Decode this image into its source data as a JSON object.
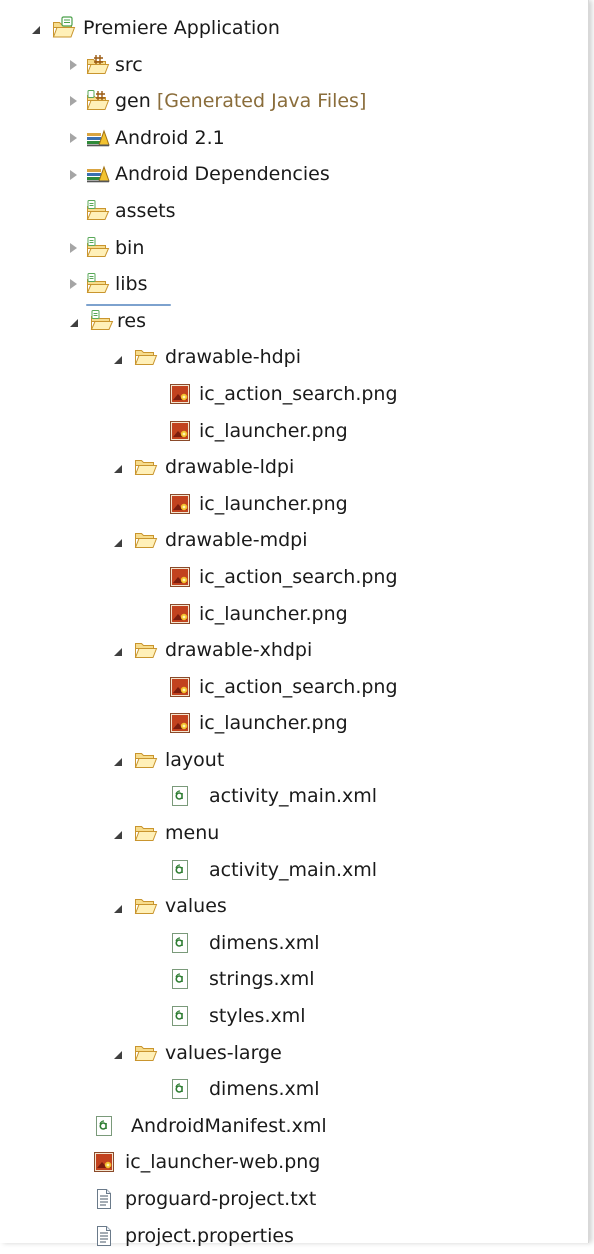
{
  "tree": {
    "project": {
      "label": "Premiere Application"
    },
    "src": {
      "label": "src"
    },
    "gen": {
      "label": "gen",
      "suffix": "[Generated Java Files]"
    },
    "android_lib": {
      "label": "Android 2.1"
    },
    "android_deps": {
      "label": "Android Dependencies"
    },
    "assets": {
      "label": "assets"
    },
    "bin": {
      "label": "bin"
    },
    "libs": {
      "label": "libs"
    },
    "res": {
      "label": "res"
    },
    "drawable_hdpi": {
      "label": "drawable-hdpi"
    },
    "hdpi_search": {
      "label": "ic_action_search.png"
    },
    "hdpi_launcher": {
      "label": "ic_launcher.png"
    },
    "drawable_ldpi": {
      "label": "drawable-ldpi"
    },
    "ldpi_launcher": {
      "label": "ic_launcher.png"
    },
    "drawable_mdpi": {
      "label": "drawable-mdpi"
    },
    "mdpi_search": {
      "label": "ic_action_search.png"
    },
    "mdpi_launcher": {
      "label": "ic_launcher.png"
    },
    "drawable_xhdpi": {
      "label": "drawable-xhdpi"
    },
    "xhdpi_search": {
      "label": "ic_action_search.png"
    },
    "xhdpi_launcher": {
      "label": "ic_launcher.png"
    },
    "layout": {
      "label": "layout"
    },
    "layout_main": {
      "label": "activity_main.xml"
    },
    "menu": {
      "label": "menu"
    },
    "menu_main": {
      "label": "activity_main.xml"
    },
    "values": {
      "label": "values"
    },
    "values_dimens": {
      "label": "dimens.xml"
    },
    "values_strings": {
      "label": "strings.xml"
    },
    "values_styles": {
      "label": "styles.xml"
    },
    "values_large": {
      "label": "values-large"
    },
    "values_large_dimens": {
      "label": "dimens.xml"
    },
    "manifest": {
      "label": "AndroidManifest.xml"
    },
    "web_icon": {
      "label": "ic_launcher-web.png"
    },
    "proguard": {
      "label": "proguard-project.txt"
    },
    "properties": {
      "label": "project.properties"
    }
  },
  "icons": {
    "project": "android-project-icon",
    "source_folder": "source-folder-icon",
    "library": "library-icon",
    "android_folder": "android-folder-icon",
    "folder": "folder-icon",
    "png": "png-file-icon",
    "xml": "xml-file-icon",
    "text": "text-file-icon"
  },
  "colors": {
    "selection_border": "#7da2ce",
    "selection_fill": "#dcebfc",
    "decoration_text": "#8a6d3b"
  }
}
